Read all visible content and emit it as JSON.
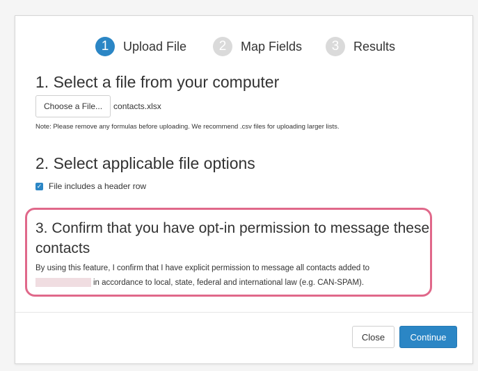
{
  "steps": [
    {
      "number": "1",
      "label": "Upload File",
      "active": true
    },
    {
      "number": "2",
      "label": "Map Fields",
      "active": false
    },
    {
      "number": "3",
      "label": "Results",
      "active": false
    }
  ],
  "section1": {
    "title": "1. Select a file from your computer",
    "choose_button": "Choose a File...",
    "file_name": "contacts.xlsx",
    "note": "Note: Please remove any formulas before uploading. We recommend .csv files for uploading larger lists."
  },
  "section2": {
    "title": "2. Select applicable file options",
    "checkbox_checked": true,
    "checkbox_label": "File includes a header row"
  },
  "section3": {
    "title": "3. Confirm that you have opt-in permission to message these contacts",
    "body_line1": "By using this feature, I confirm that I have explicit permission to message all contacts added to",
    "body_line2": "in accordance to local, state, federal and international law (e.g. CAN-SPAM)."
  },
  "footer": {
    "close_label": "Close",
    "continue_label": "Continue"
  },
  "colors": {
    "accent": "#2b86c5",
    "inactive_step": "#dadada",
    "highlight_border": "#e0688a"
  }
}
